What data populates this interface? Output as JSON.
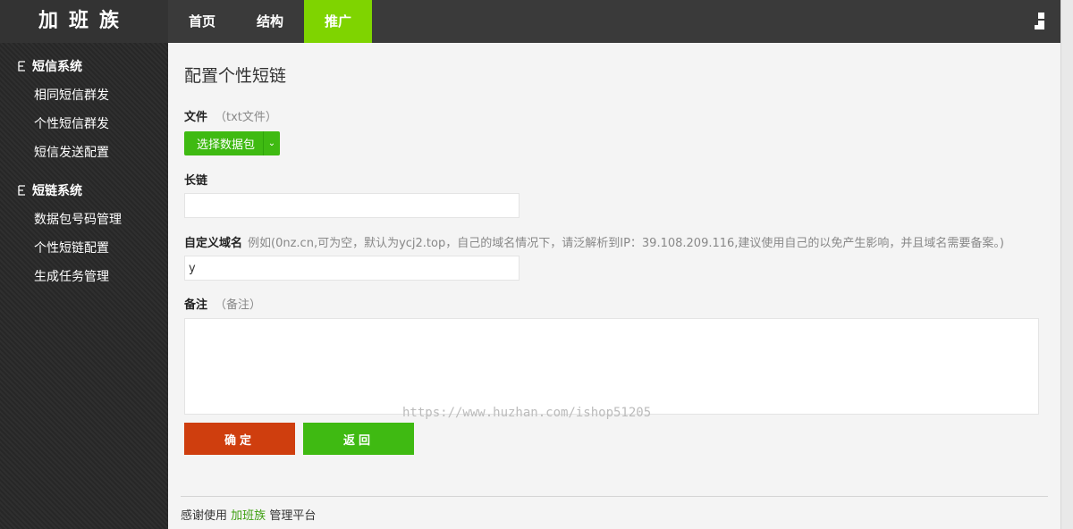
{
  "header": {
    "logo": "加班族",
    "nav": [
      {
        "label": "首页",
        "active": false
      },
      {
        "label": "结构",
        "active": false
      },
      {
        "label": "推广",
        "active": true
      }
    ],
    "active_color": "#7fd400"
  },
  "sidebar": {
    "groups": [
      {
        "title": "短信系统",
        "items": [
          "相同短信群发",
          "个性短信群发",
          "短信发送配置"
        ]
      },
      {
        "title": "短链系统",
        "items": [
          "数据包号码管理",
          "个性短链配置",
          "生成任务管理"
        ]
      }
    ]
  },
  "form": {
    "title": "配置个性短链",
    "file": {
      "label": "文件",
      "hint": "（txt文件）",
      "button_label": "选择数据包"
    },
    "long_link": {
      "label": "长链",
      "value": ""
    },
    "domain": {
      "label": "自定义域名",
      "hint": "例如(0nz.cn,可为空，默认为ycj2.top，自己的域名情况下，请泛解析到IP：39.108.209.116,建议使用自己的以免产生影响，并且域名需要备案。)",
      "value": "y"
    },
    "remark": {
      "label": "备注",
      "hint": "（备注）",
      "value": ""
    },
    "confirm_label": "确定",
    "back_label": "返回",
    "confirm_color": "#cf3e0e",
    "back_color": "#3fba12"
  },
  "watermark": "https://www.huzhan.com/ishop51205",
  "footer": {
    "prefix": "感谢使用",
    "brand": "加班族",
    "suffix": "管理平台"
  }
}
